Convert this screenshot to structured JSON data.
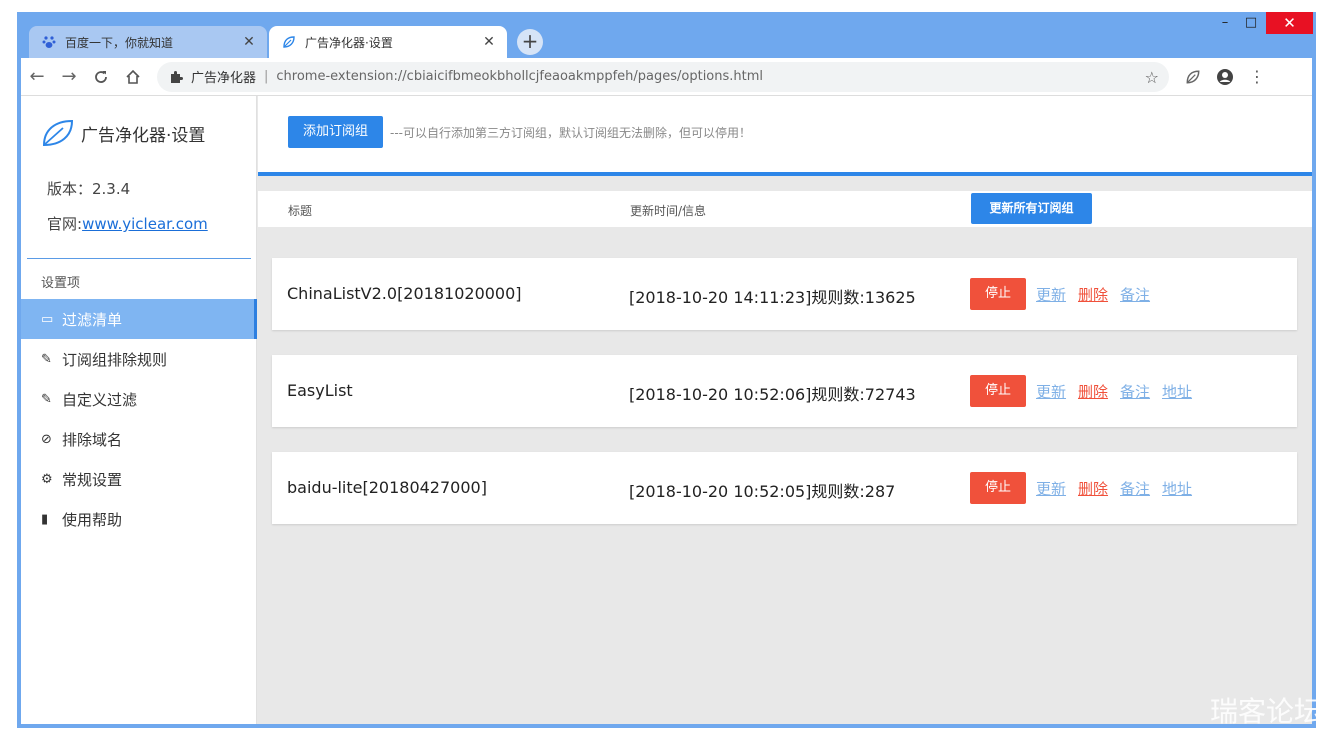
{
  "browser": {
    "tabs": [
      {
        "title": "百度一下，你就知道",
        "active": false
      },
      {
        "title": "广告净化器·设置",
        "active": true
      }
    ],
    "new_tab": "+",
    "window_controls": {
      "minimize": "–",
      "maximize": "□",
      "close": "✕"
    },
    "nav": {
      "back": "←",
      "forward": "→",
      "reload": "C",
      "home": "⌂"
    },
    "address": {
      "ext_name": "广告净化器",
      "separator": "|",
      "url": "chrome-extension://cbiaicifbmeokbhollcjfeaoakmppfeh/pages/options.html"
    }
  },
  "sidebar": {
    "brand": "广告净化器·设置",
    "version": "版本：2.3.4",
    "site_label": "官网:",
    "site_link": "www.yiclear.com",
    "section_title": "设置项",
    "items": [
      {
        "label": "过滤清单",
        "icon": "▭",
        "icon_name": "list-icon",
        "active": true
      },
      {
        "label": "订阅组排除规则",
        "icon": "✎",
        "icon_name": "pencil-icon"
      },
      {
        "label": "自定义过滤",
        "icon": "✎",
        "icon_name": "pencil-icon"
      },
      {
        "label": "排除域名",
        "icon": "⊘",
        "icon_name": "ban-icon"
      },
      {
        "label": "常规设置",
        "icon": "⚙",
        "icon_name": "gears-icon"
      },
      {
        "label": "使用帮助",
        "icon": "▮",
        "icon_name": "book-icon"
      }
    ]
  },
  "main": {
    "add_button": "添加订阅组",
    "hint": "---可以自行添加第三方订阅组，默认订阅组无法删除，但可以停用！",
    "columns": {
      "title": "标题",
      "update": "更新时间/信息"
    },
    "update_all": "更新所有订阅组",
    "rows": [
      {
        "title": "ChinaListV2.0[20181020000]",
        "info": "[2018-10-20 14:11:23]规则数:13625",
        "stop": "停止",
        "update": "更新",
        "delete": "删除",
        "note": "备注"
      },
      {
        "title": "EasyList",
        "info": "[2018-10-20 10:52:06]规则数:72743",
        "stop": "停止",
        "update": "更新",
        "delete": "删除",
        "note": "备注",
        "address": "地址"
      },
      {
        "title": "baidu-lite[20180427000]",
        "info": "[2018-10-20 10:52:05]规则数:287",
        "stop": "停止",
        "update": "更新",
        "delete": "删除",
        "note": "备注",
        "address": "地址"
      }
    ]
  },
  "watermark": "瑞客论坛",
  "colors": {
    "accent": "#2d86e8",
    "danger": "#f0513b",
    "link": "#7fb0e6",
    "frame": "#6fa8ee"
  }
}
